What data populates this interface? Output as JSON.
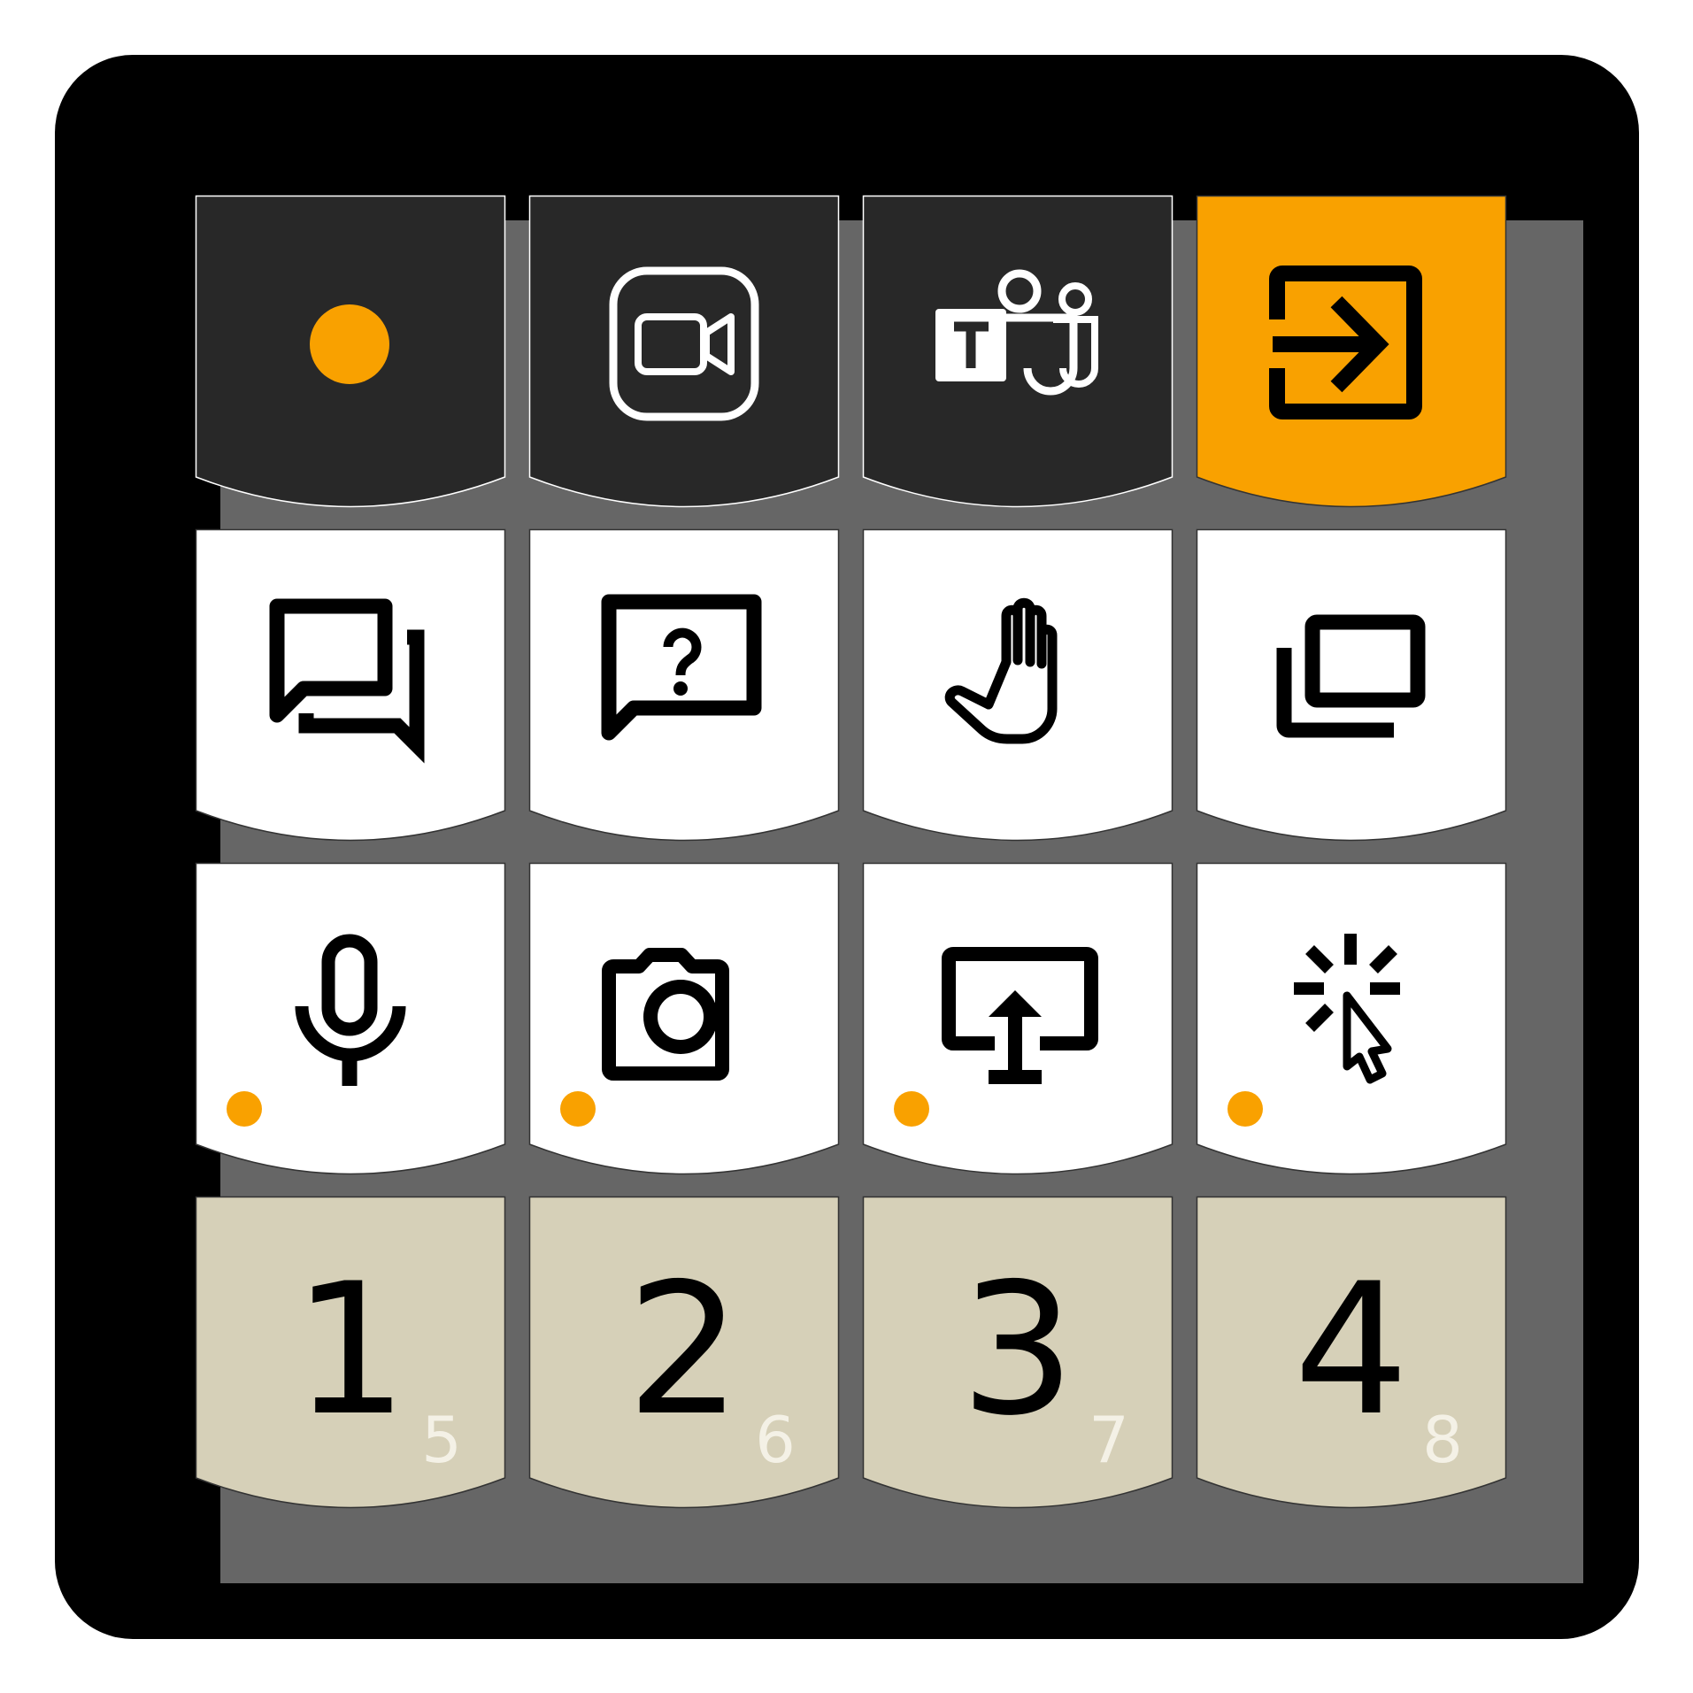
{
  "colors": {
    "device": "#000000",
    "panel": "#666666",
    "key_dark": "#282828",
    "key_white": "#ffffff",
    "key_orange": "#f9a100",
    "key_beige": "#d6d0b8",
    "accent": "#f9a100",
    "sub_number": "#f4f1e6",
    "icon_dark": "#000000",
    "icon_light": "#ffffff"
  },
  "keys": {
    "row1": [
      {
        "icon": "record-dot-icon",
        "style": "dark"
      },
      {
        "icon": "zoom-video-icon",
        "style": "dark"
      },
      {
        "icon": "microsoft-teams-icon",
        "style": "dark"
      },
      {
        "icon": "enter-exit-icon",
        "style": "orange"
      }
    ],
    "row2": [
      {
        "icon": "chat-bubbles-icon",
        "style": "white"
      },
      {
        "icon": "question-bubble-icon",
        "style": "white"
      },
      {
        "icon": "raise-hand-icon",
        "style": "white"
      },
      {
        "icon": "switch-windows-icon",
        "style": "white"
      }
    ],
    "row3": [
      {
        "icon": "microphone-icon",
        "style": "white",
        "indicator": true
      },
      {
        "icon": "camera-icon",
        "style": "white",
        "indicator": true
      },
      {
        "icon": "share-screen-icon",
        "style": "white",
        "indicator": true
      },
      {
        "icon": "pointer-click-icon",
        "style": "white",
        "indicator": true
      }
    ],
    "row4": [
      {
        "label": "1",
        "sub": "5",
        "style": "beige"
      },
      {
        "label": "2",
        "sub": "6",
        "style": "beige"
      },
      {
        "label": "3",
        "sub": "7",
        "style": "beige"
      },
      {
        "label": "4",
        "sub": "8",
        "style": "beige"
      }
    ]
  }
}
